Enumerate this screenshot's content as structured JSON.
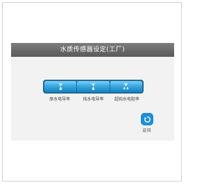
{
  "header": {
    "title": "水质传感器设定(工厂)"
  },
  "sensors": [
    {
      "label": "原水电导率",
      "icon": "faucet-drop-icon"
    },
    {
      "label": "纯水电导率",
      "icon": "faucet-drop-icon"
    },
    {
      "label": "超纯水电阻率",
      "icon": "faucet-drops-icon"
    }
  ],
  "return_button": {
    "label": "返回",
    "icon": "return-arrow-icon"
  },
  "colors": {
    "title_bar": "#666666",
    "button_blue": "#2a9ad6",
    "button_border": "#1f6a94",
    "return_blue": "#1b8fd6",
    "screen_bg": "#f2f2f2"
  }
}
